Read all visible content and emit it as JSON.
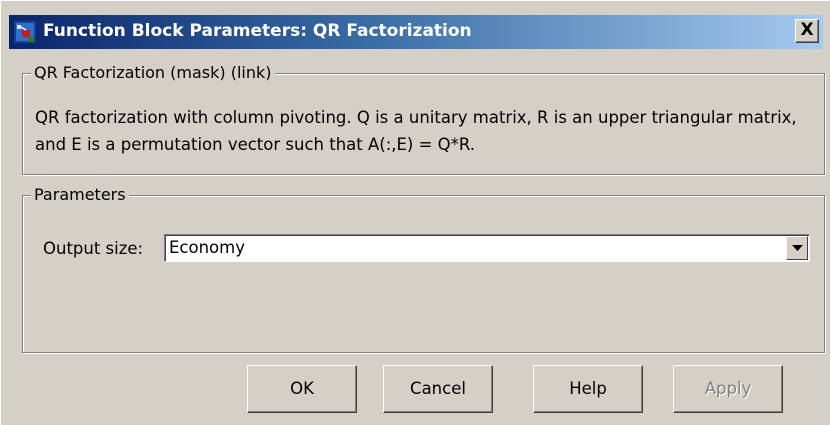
{
  "window": {
    "title": "Function Block Parameters: QR Factorization",
    "app_icon": "simulink-block-icon",
    "close_label": "X"
  },
  "description_group": {
    "legend": "QR Factorization (mask) (link)",
    "text": "QR factorization with column pivoting. Q is a unitary matrix, R is an upper triangular matrix, and E is a permutation vector such that A(:,E) = Q*R."
  },
  "parameters_group": {
    "legend": "Parameters",
    "output_size": {
      "label": "Output size:",
      "value": "Economy"
    }
  },
  "buttons": {
    "ok": "OK",
    "cancel": "Cancel",
    "help": "Help",
    "apply": "Apply",
    "apply_enabled": false
  },
  "colors": {
    "titlebar_start": "#0a246a",
    "titlebar_end": "#a6caf0",
    "dialog_background": "#d4d0c8",
    "disabled_text": "#808080"
  }
}
